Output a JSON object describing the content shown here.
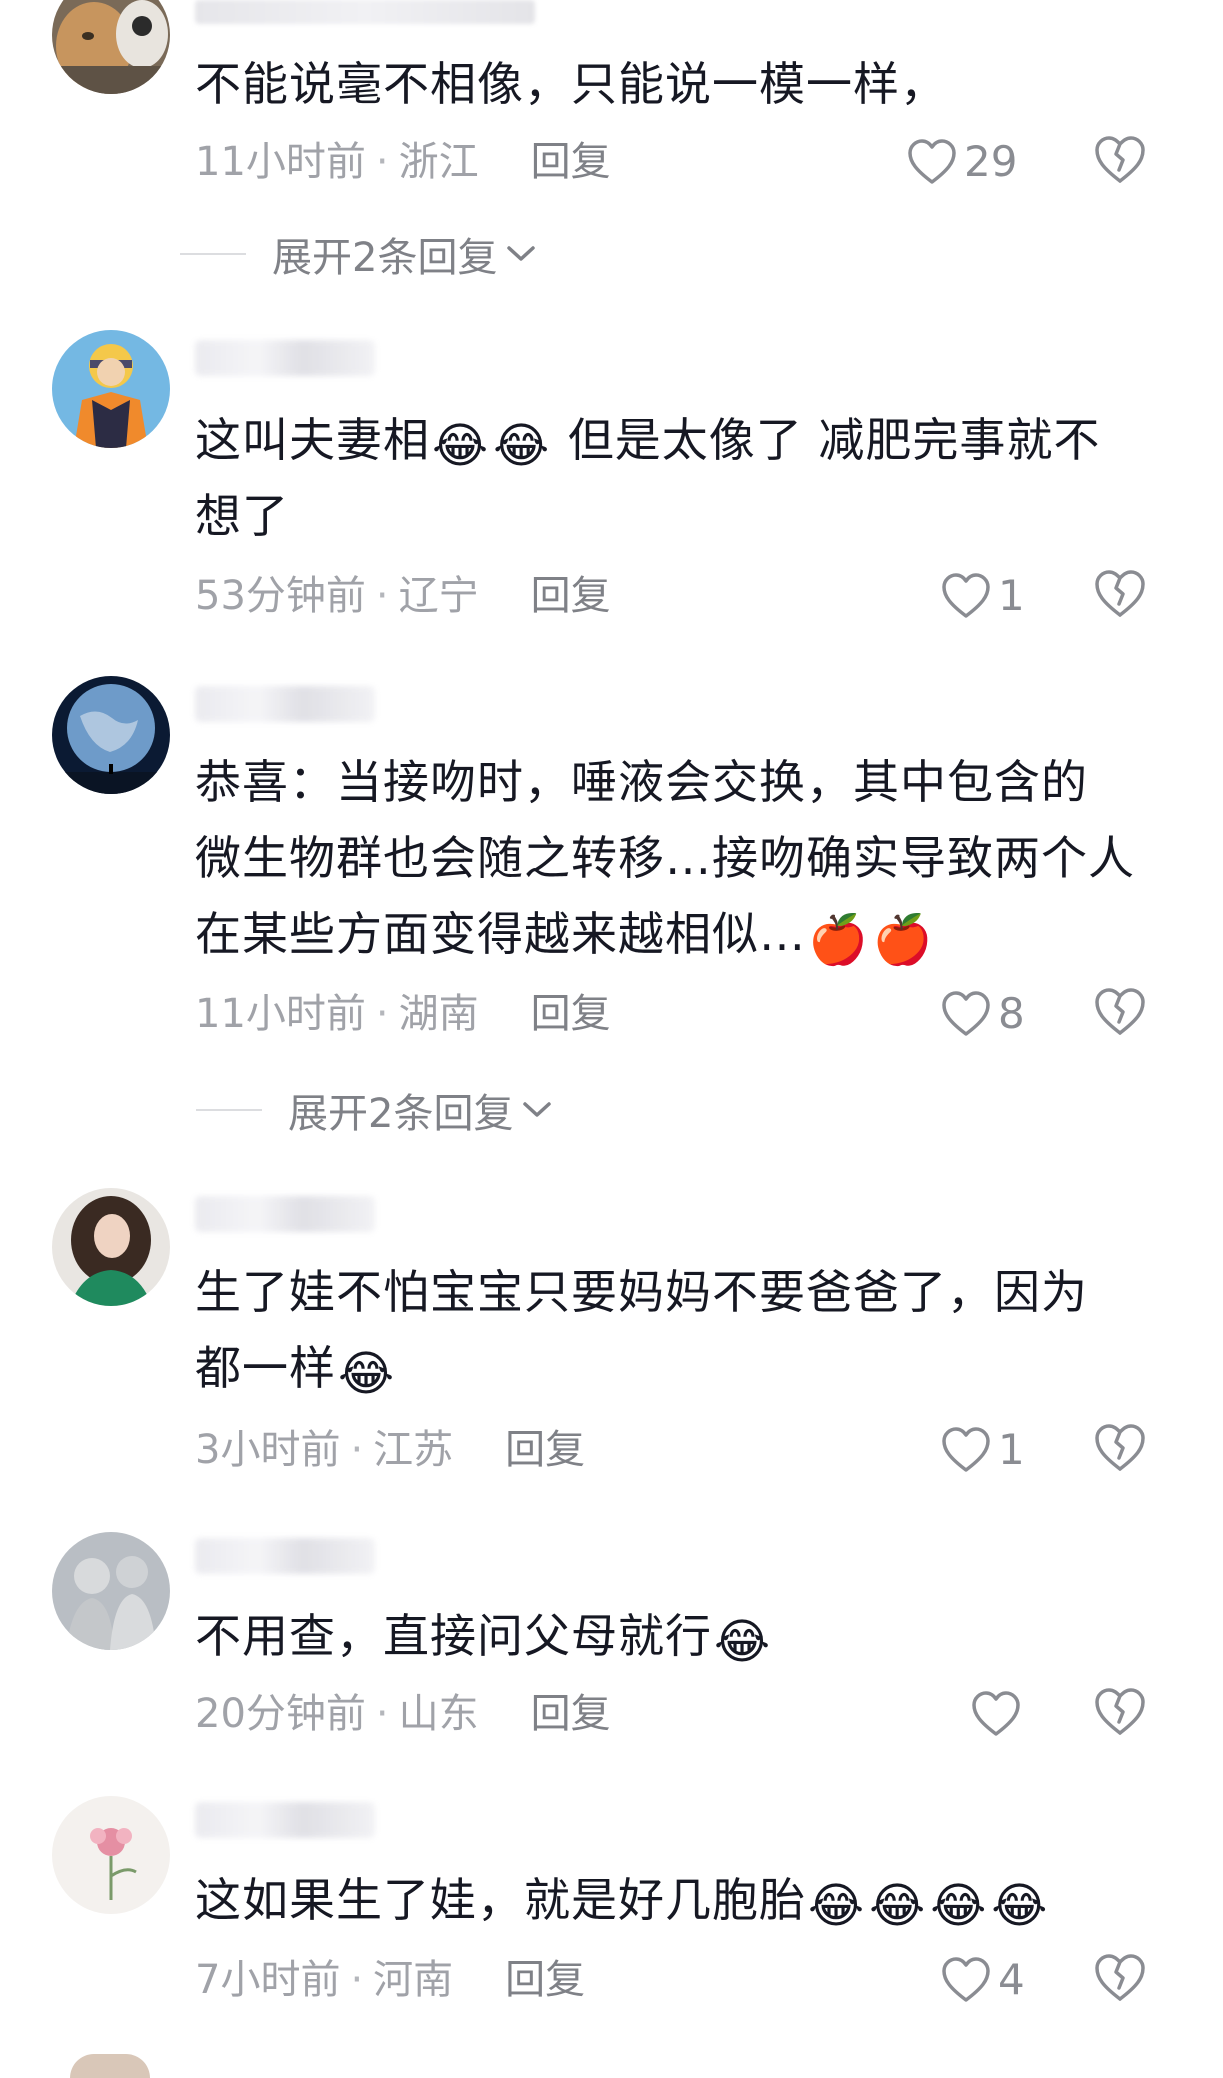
{
  "comments": [
    {
      "avatar": "cat-avatar",
      "text": "不能说毫不相像，只能说一模一样，",
      "time": "11小时前",
      "region": "浙江",
      "reply": "回复",
      "likes": "29",
      "expand": "展开2条回复"
    },
    {
      "avatar": "anime-avatar",
      "text_line1_a": "这叫夫妻相",
      "text_line1_b": " 但是太像了 减肥完事就不",
      "text_line2": "想了",
      "emoji": "😂",
      "time": "53分钟前",
      "region": "辽宁",
      "reply": "回复",
      "likes": "1"
    },
    {
      "avatar": "earth-avatar",
      "text_line1": "恭喜：当接吻时，唾液会交换，其中包含的",
      "text_line2": "微生物群也会随之转移…接吻确实导致两个人",
      "text_line3": "在某些方面变得越来越相似…",
      "emoji": "🍎",
      "time": "11小时前",
      "region": "湖南",
      "reply": "回复",
      "likes": "8",
      "expand": "展开2条回复"
    },
    {
      "avatar": "woman-avatar",
      "text_line1": "生了娃不怕宝宝只要妈妈不要爸爸了，因为",
      "text_line2": "都一样",
      "emoji": "😂",
      "time": "3小时前",
      "region": "江苏",
      "reply": "回复",
      "likes": "1"
    },
    {
      "avatar": "statue-avatar",
      "text": "不用查，直接问父母就行",
      "emoji": "😂",
      "time": "20分钟前",
      "region": "山东",
      "reply": "回复",
      "likes": ""
    },
    {
      "avatar": "flower-avatar",
      "text": "这如果生了娃，就是好几胞胎",
      "emoji": "😂",
      "time": "7小时前",
      "region": "河南",
      "reply": "回复",
      "likes": "4"
    }
  ],
  "meta_separator": "·",
  "colors": {
    "text": "#161823",
    "meta": "#a0a2a8",
    "reply": "#7f8187",
    "icon": "#8a8c92"
  },
  "icons": [
    "heart-outline-icon",
    "broken-heart-icon",
    "chevron-down-icon"
  ]
}
